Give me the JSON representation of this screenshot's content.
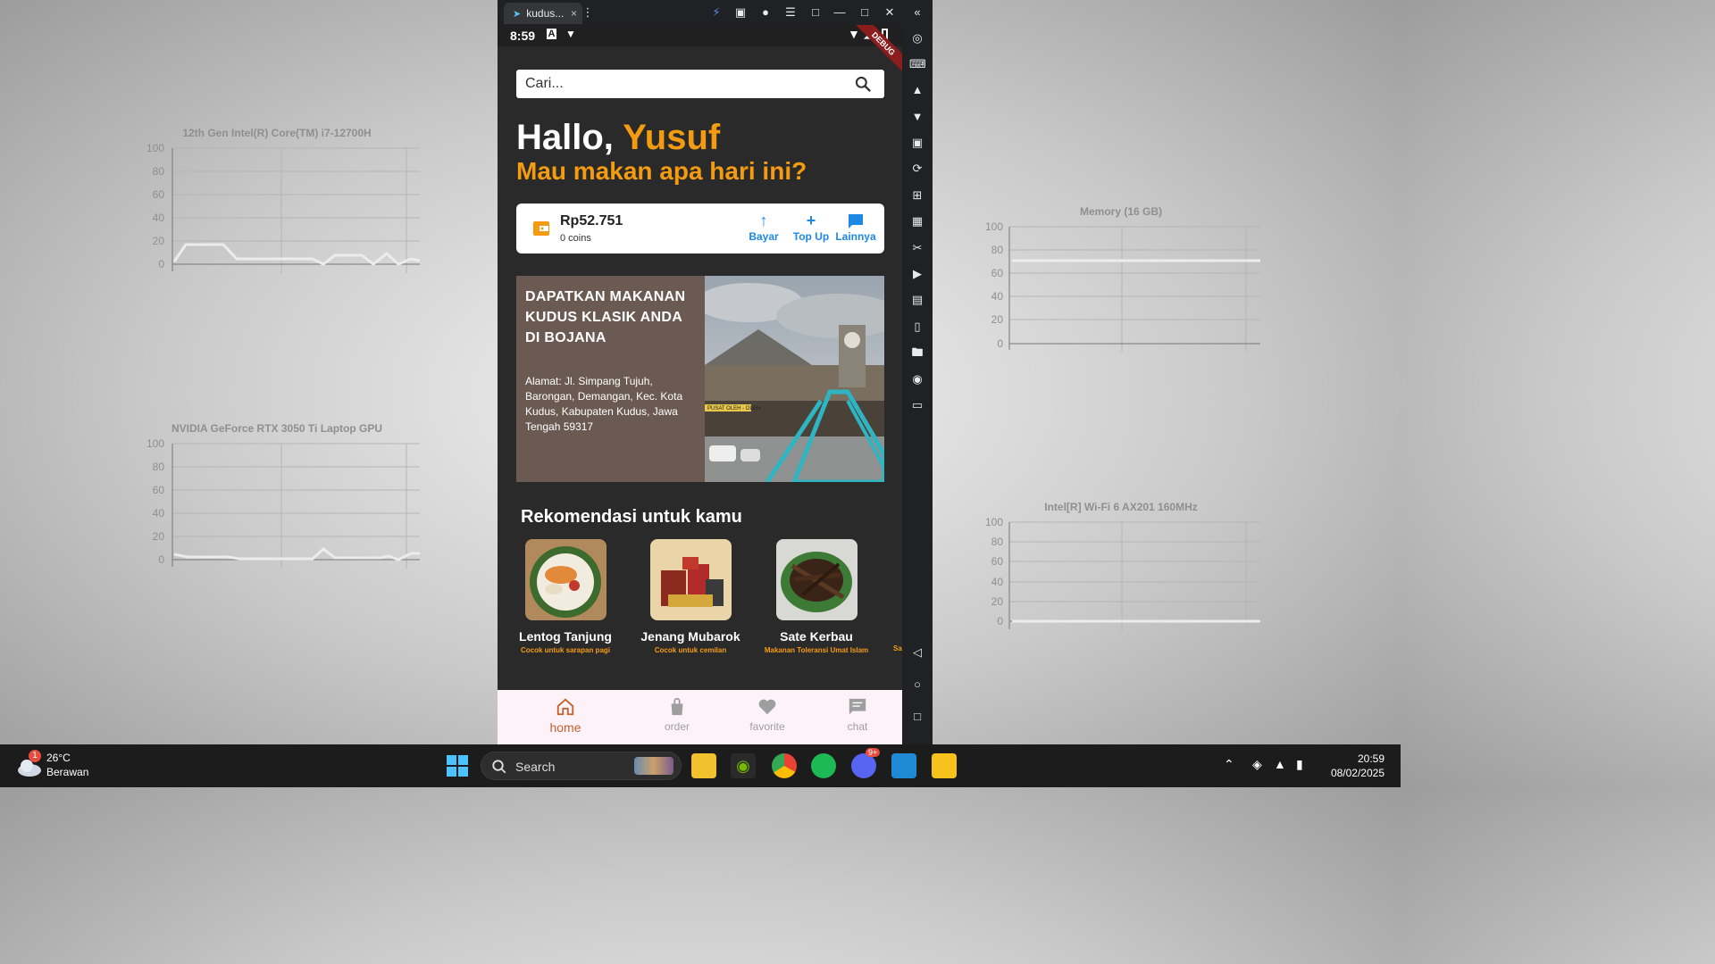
{
  "desktop": {
    "cpu_title": "12th Gen Intel(R) Core(TM) i7-12700H",
    "gpu_title": "NVIDIA GeForce RTX 3050 Ti Laptop GPU",
    "mem_title": "Memory (16 GB)",
    "wifi_title": "Intel[R] Wi-Fi 6 AX201 160MHz",
    "yticks": [
      "100",
      "80",
      "60",
      "40",
      "20",
      "0"
    ]
  },
  "emulator": {
    "tab_title": "kudus...",
    "tab_close": "×"
  },
  "app": {
    "status_time": "8:59",
    "debug_label": "DEBUG",
    "search_placeholder": "Cari...",
    "greeting_prefix": "Hallo, ",
    "greeting_name": "Yusuf",
    "subtitle": "Mau makan apa hari ini?",
    "wallet": {
      "balance": "Rp52.751",
      "coins": "0 coins",
      "actions": [
        "Bayar",
        "Top Up",
        "Lainnya"
      ]
    },
    "banner": {
      "title": "DAPATKAN MAKANAN KUDUS KLASIK ANDA DI BOJANA",
      "address": "Alamat: Jl. Simpang Tujuh, Barongan, Demangan, Kec. Kota Kudus, Kabupaten Kudus, Jawa Tengah 59317",
      "sign_text": "PUSAT OLEH - OLEH"
    },
    "recommend_title": "Rekomendasi untuk kamu",
    "recommendations": [
      {
        "name": "Lentog Tanjung",
        "desc": "Cocok untuk sarapan pagi"
      },
      {
        "name": "Jenang Mubarok",
        "desc": "Cocok untuk cemilan"
      },
      {
        "name": "Sate Kerbau",
        "desc": "Makanan Toleransi Umat Islam"
      },
      {
        "name": "Sa",
        "desc": "Sa"
      }
    ],
    "nav": [
      "home",
      "order",
      "favorite",
      "chat"
    ]
  },
  "taskbar": {
    "weather_badge": "1",
    "weather_temp": "26°C",
    "weather_desc": "Berawan",
    "search_label": "Search",
    "discord_badge": "9+",
    "time": "20:59",
    "date": "08/02/2025"
  },
  "colors": {
    "accent": "#f39c12",
    "wallet_blue": "#1e88e5",
    "nav_active": "#c0622e",
    "banner_bg": "#6a5a52"
  }
}
